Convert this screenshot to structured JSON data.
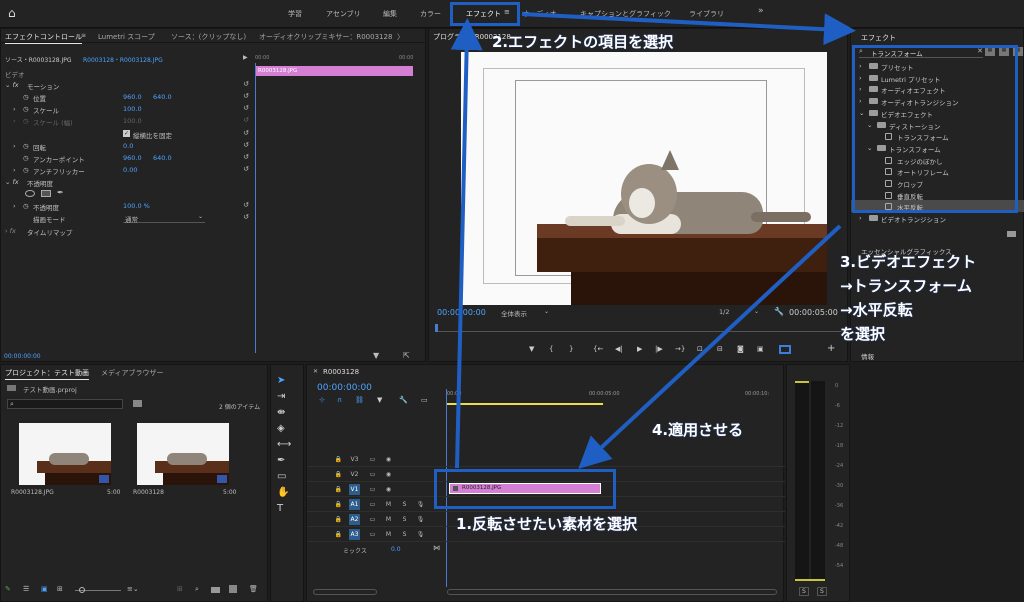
{
  "workspaces": [
    "学習",
    "アセンブリ",
    "編集",
    "カラー",
    "エフェクト",
    "オーディオ",
    "キャプションとグラフィック",
    "ライブラリ"
  ],
  "overflow": "»",
  "effect_controls": {
    "tabs": [
      "エフェクトコントロール",
      "Lumetri スコープ",
      "ソース：(クリップなし)",
      "オーディオクリップミキサー：R0003128"
    ],
    "tab_more": "〉",
    "source_label": "ソース・R0003128.JPG",
    "sequence_label": "R0003128・R0003128.JPG",
    "mini_time_start": "00:00",
    "mini_time_end": "00:00",
    "clip_label": "R0003128.JPG",
    "video_header": "ビデオ",
    "motion": "モーション",
    "position": "位置",
    "position_x": "960.0",
    "position_y": "640.0",
    "scale": "スケール",
    "scale_val": "100.0",
    "scale_w": "スケール (幅)",
    "scale_w_val": "100.0",
    "uniform_scale": "縦横比を固定",
    "rotation": "回転",
    "rotation_val": "0.0",
    "anchor": "アンカーポイント",
    "anchor_x": "960.0",
    "anchor_y": "640.0",
    "antiflicker": "アンチフリッカー",
    "antiflicker_val": "0.00",
    "opacity_header": "不透明度",
    "opacity": "不透明度",
    "opacity_val": "100.0 %",
    "blend": "描画モード",
    "blend_val": "通常",
    "time_remap": "タイムリマップ",
    "time": "00:00:00:00"
  },
  "program": {
    "title": "プログラム：R0003128",
    "timecode": "00:00:00:00",
    "fit": "全体表示",
    "quality": "1/2",
    "duration": "00:00:05:00"
  },
  "effects_panel": {
    "title": "エフェクト",
    "search": "トランスフォーム",
    "items": [
      {
        "label": "プリセット",
        "level": 0,
        "type": "folder"
      },
      {
        "label": "Lumetri プリセット",
        "level": 0,
        "type": "folder"
      },
      {
        "label": "オーディオエフェクト",
        "level": 0,
        "type": "folder"
      },
      {
        "label": "オーディオトランジション",
        "level": 0,
        "type": "folder"
      },
      {
        "label": "ビデオエフェクト",
        "level": 0,
        "type": "folder"
      },
      {
        "label": "ディストーション",
        "level": 1,
        "type": "folder"
      },
      {
        "label": "トランスフォーム",
        "level": 2,
        "type": "effect"
      },
      {
        "label": "トランスフォーム",
        "level": 1,
        "type": "folder"
      },
      {
        "label": "エッジのぼかし",
        "level": 2,
        "type": "effect"
      },
      {
        "label": "オートリフレーム",
        "level": 2,
        "type": "effect"
      },
      {
        "label": "クロップ",
        "level": 2,
        "type": "effect"
      },
      {
        "label": "垂直反転",
        "level": 2,
        "type": "effect"
      },
      {
        "label": "水平反転",
        "level": 2,
        "type": "effect",
        "selected": true
      },
      {
        "label": "ビデオトランジション",
        "level": 0,
        "type": "folder"
      }
    ],
    "next_panel": "エッセンシャルグラフィックス",
    "info": "情報"
  },
  "project": {
    "tabs": [
      "プロジェクト：テスト動画",
      "メディアブラウザー"
    ],
    "file": "テスト動画.prproj",
    "count": "2 個のアイテム",
    "thumbs": [
      {
        "name": "R0003128.JPG",
        "dur": "5:00"
      },
      {
        "name": "R0003128",
        "dur": "5:00"
      }
    ]
  },
  "timeline": {
    "title": "R0003128",
    "timecode": "00:00:00:00",
    "ruler": [
      "00:00",
      "00:00:05:00",
      "00:00:10:"
    ],
    "video_tracks": [
      "V3",
      "V2",
      "V1"
    ],
    "audio_tracks": [
      "A1",
      "A2",
      "A3"
    ],
    "mix": "ミックス",
    "mix_val": "0.0",
    "clip": "R0003128.JPG",
    "m": "M",
    "s": "S"
  },
  "meter": {
    "ticks": [
      "0",
      "-6",
      "-12",
      "-18",
      "-24",
      "-30",
      "-36",
      "-42",
      "-48",
      "-54"
    ],
    "solo": [
      "S",
      "S"
    ]
  },
  "annotations": {
    "a1": "1.反転させたい素材を選択",
    "a2": "2.エフェクトの項目を選択",
    "a3_1": "3.ビデオエフェクト",
    "a3_2": "→トランスフォーム",
    "a3_3": "→水平反転",
    "a3_4": "を選択",
    "a4": "4.適用させる"
  },
  "colors": {
    "accent": "#1f5fc4",
    "clip": "#d47fd4",
    "time": "#4ea3ff"
  }
}
